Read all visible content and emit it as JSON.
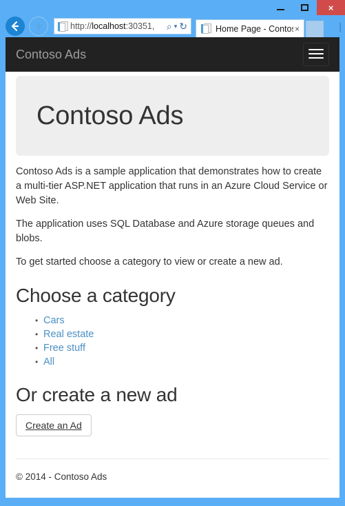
{
  "browser": {
    "window_controls": {
      "minimize_label": "Minimize",
      "maximize_label": "Maximize",
      "close_label": "×"
    },
    "back_label": "Back",
    "forward_label": "Forward",
    "address": {
      "url_prefix": "http://",
      "url_host": "localhost",
      "url_rest": ":30351,",
      "search_icon": "⌕",
      "caret_icon": "▾",
      "refresh_icon": "↻"
    },
    "tab": {
      "title": "Home Page - Contoso...",
      "close_icon": "×"
    },
    "edge_hint": "│"
  },
  "page": {
    "navbar": {
      "brand": "Contoso Ads"
    },
    "jumbotron": {
      "heading": "Contoso Ads"
    },
    "paragraphs": [
      "Contoso Ads is a sample application that demonstrates how to create a multi-tier ASP.NET application that runs in an Azure Cloud Service or Web Site.",
      "The application uses SQL Database and Azure storage queues and blobs.",
      "To get started choose a category to view or create a new ad."
    ],
    "category_section": {
      "heading": "Choose a category",
      "links": [
        {
          "label": "Cars"
        },
        {
          "label": "Real estate"
        },
        {
          "label": "Free stuff"
        },
        {
          "label": "All"
        }
      ]
    },
    "create_section": {
      "heading": "Or create a new ad",
      "button_label": "Create an Ad"
    },
    "footer": {
      "text": "© 2014 - Contoso Ads"
    }
  },
  "colors": {
    "window_border": "#5aaef5",
    "navbar_bg": "#222222",
    "brand_text": "#9d9d9d",
    "jumbotron_bg": "#eeeeee",
    "link_blue": "#4a90c4",
    "close_button": "#d14b4b"
  }
}
